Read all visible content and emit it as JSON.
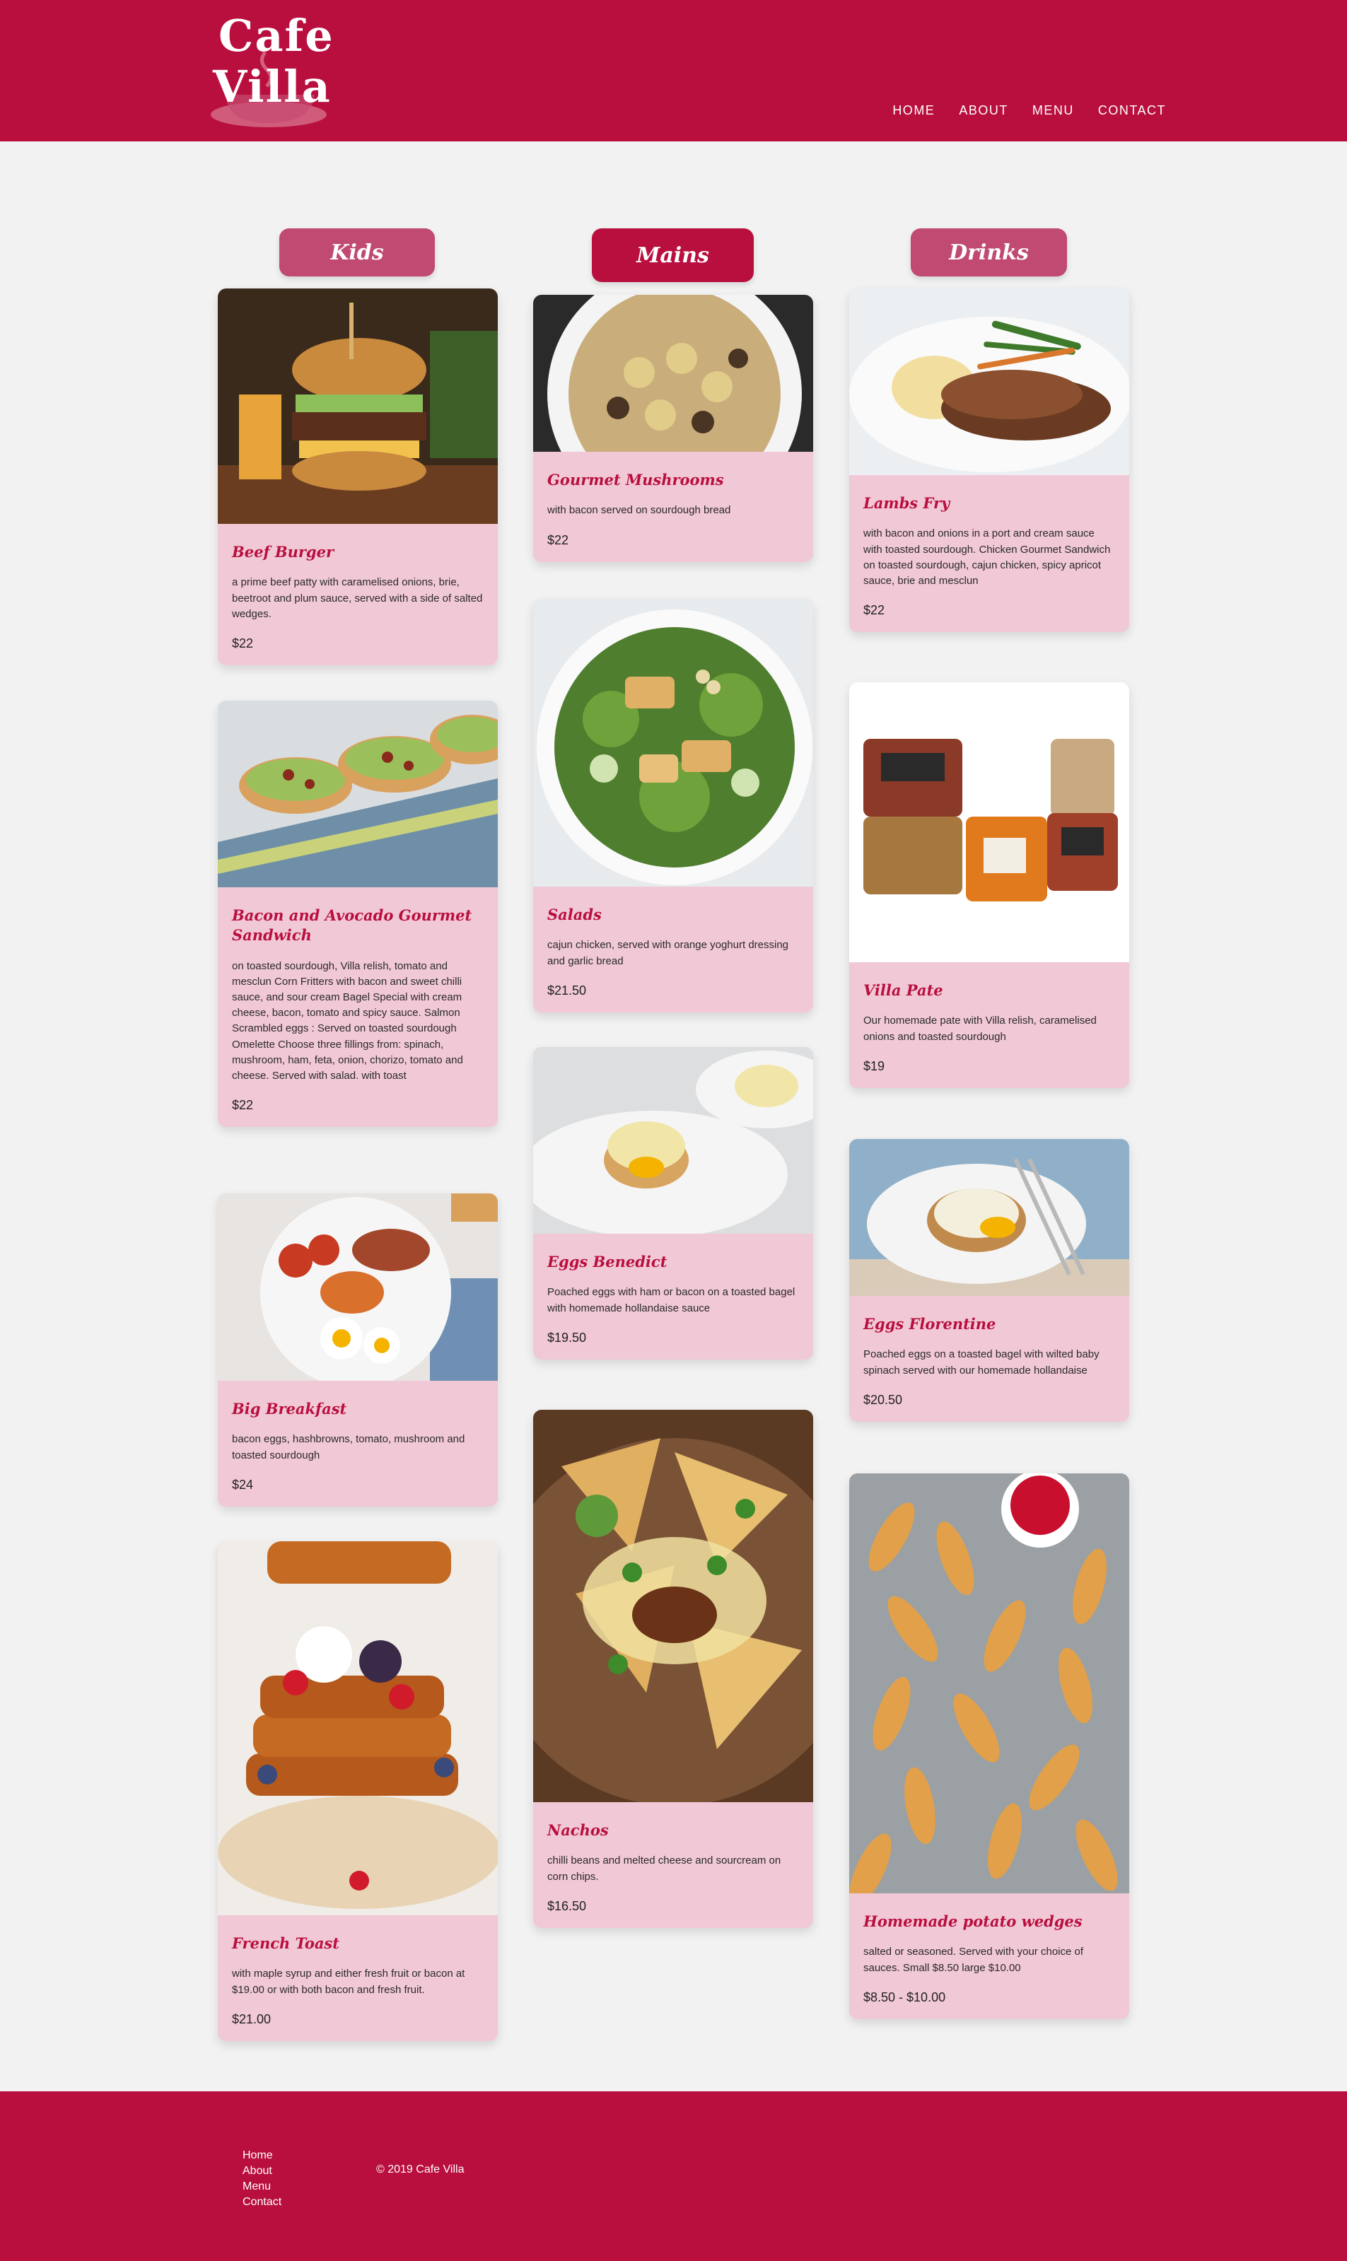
{
  "brand": {
    "logo_line1": "Cafe",
    "logo_line2": "Villa"
  },
  "nav": [
    "HOME",
    "ABOUT",
    "MENU",
    "CONTACT"
  ],
  "categories": {
    "kids": "Kids",
    "mains": "Mains",
    "drinks": "Drinks"
  },
  "kids": [
    {
      "title": "Beef Burger",
      "desc": "a prime beef patty with caramelised onions, brie, beetroot and plum sauce, served with a side of salted wedges.",
      "price": "$22"
    },
    {
      "title": "Bacon and Avocado Gourmet Sandwich",
      "desc": "on toasted sourdough, Villa relish, tomato and mesclun Corn Fritters with bacon and sweet chilli sauce, and sour cream Bagel Special with cream cheese, bacon, tomato and spicy sauce. Salmon Scrambled eggs : Served on toasted sourdough Omelette Choose three fillings from: spinach, mushroom, ham, feta, onion, chorizo, tomato and cheese. Served with salad. with toast",
      "price": "$22"
    },
    {
      "title": "Big Breakfast",
      "desc": "bacon eggs, hashbrowns, tomato, mushroom and toasted sourdough",
      "price": "$24"
    },
    {
      "title": "French Toast",
      "desc": "with maple syrup and either fresh fruit or bacon at $19.00 or with both bacon and fresh fruit.",
      "price": "$21.00"
    }
  ],
  "mains": [
    {
      "title": "Gourmet Mushrooms",
      "desc": "with bacon served on sourdough bread",
      "price": "$22"
    },
    {
      "title": "Salads",
      "desc": "cajun chicken, served with orange yoghurt dressing and garlic bread",
      "price": "$21.50"
    },
    {
      "title": "Eggs Benedict",
      "desc": "Poached eggs with ham or bacon on a toasted bagel with homemade hollandaise sauce",
      "price": "$19.50"
    },
    {
      "title": "Nachos",
      "desc": "chilli beans and melted cheese and sourcream on corn chips.",
      "price": "$16.50"
    }
  ],
  "drinks": [
    {
      "title": "Lambs Fry",
      "desc": "with bacon and onions in a port and cream sauce with toasted sourdough. Chicken Gourmet Sandwich on toasted sourdough, cajun chicken, spicy apricot sauce, brie and mesclun",
      "price": "$22"
    },
    {
      "title": "Villa Pate",
      "desc": "Our homemade pate with Villa relish, caramelised onions and toasted sourdough",
      "price": "$19"
    },
    {
      "title": "Eggs Florentine",
      "desc": "Poached eggs on a toasted bagel with wilted baby spinach served with our homemade hollandaise",
      "price": "$20.50"
    },
    {
      "title": "Homemade potato wedges",
      "desc": "salted or seasoned. Served with your choice of sauces. Small $8.50 large $10.00",
      "price": "$8.50 - $10.00"
    }
  ],
  "footer": {
    "links": [
      "Home",
      "About",
      "Menu",
      "Contact"
    ],
    "copyright": "© 2019 Cafe Villa"
  },
  "colors": {
    "brand": "#b90f3f",
    "pill_light": "#c04a72",
    "card_bg": "#f1c8d6",
    "page_bg": "#f2f2f2"
  }
}
